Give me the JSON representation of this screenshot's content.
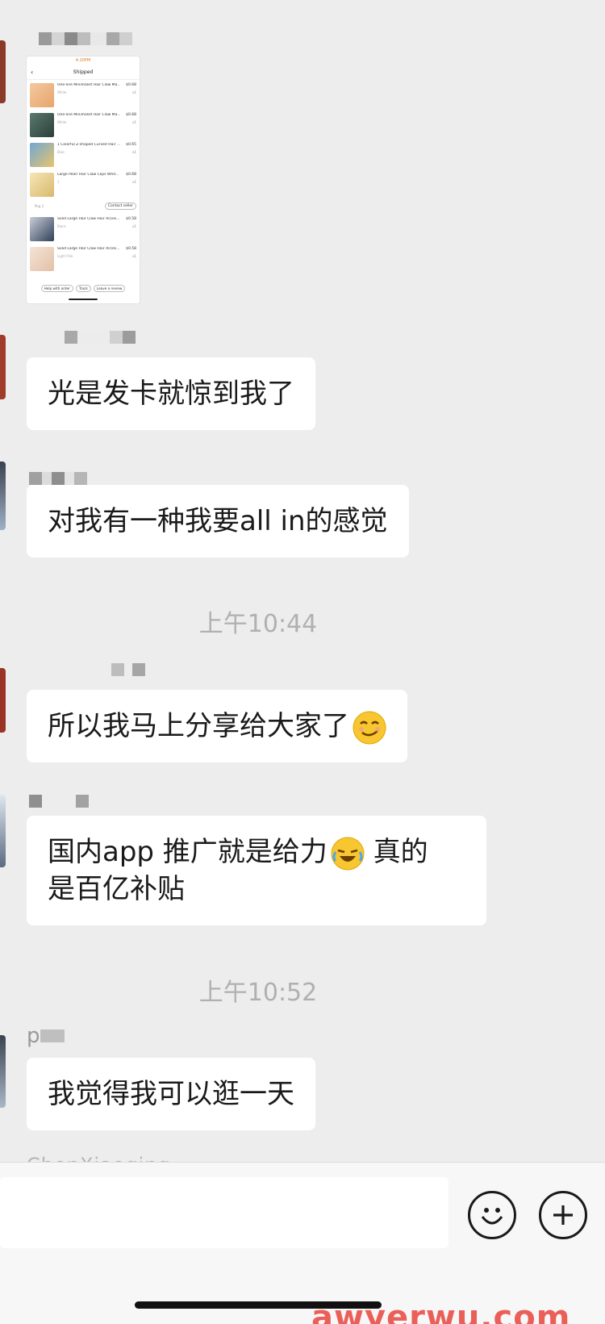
{
  "embedded_screenshot": {
    "status_time": "4:20PM",
    "title": "Shipped",
    "items": [
      {
        "name": "One-line Minimalist Hair Claw Ma...",
        "price": "$0.68",
        "variant": "White",
        "qty": "x1"
      },
      {
        "name": "One-line Minimalist Hair Claw Ma...",
        "price": "$0.68",
        "variant": "White",
        "qty": "x1"
      },
      {
        "name": "1 Colorful Z-shaped Curved Hair ...",
        "price": "$0.65",
        "variant": "Blue",
        "qty": "x1"
      },
      {
        "name": "Large Pearl Hair Claw Clips Whit...",
        "price": "$0.68",
        "variant": "1",
        "qty": "x1"
      },
      {
        "name": "Solid Large Hair Claw Hair Acces...",
        "price": "$0.58",
        "variant": "Black",
        "qty": "x1"
      },
      {
        "name": "Solid Large Hair Claw Hair Acces...",
        "price": "$0.58",
        "variant": "Light Pink",
        "qty": "x1"
      }
    ],
    "package_label": "Pkg 2",
    "contact_seller": "Contact seller",
    "actions": [
      "Help with order",
      "Track",
      "Leave a review"
    ]
  },
  "messages": [
    {
      "text": "光是发卡就惊到我了"
    },
    {
      "text": "对我有一种我要all in的感觉"
    },
    {
      "text": "所以我马上分享给大家了"
    },
    {
      "line1": "国内app 推广就是给力",
      "line1b": " 真的",
      "line2": "是百亿补贴"
    },
    {
      "text": "我觉得我可以逛一天"
    }
  ],
  "timestamps": [
    "上午10:44",
    "上午10:52"
  ],
  "sender_partial": "p",
  "sender_cut": "ChenXiaoqing",
  "watermark": "awyerwu.com",
  "icons": {
    "emoji_button": "smiley-face-icon",
    "plus_button": "plus-circle-icon"
  },
  "colors": {
    "background": "#ededed",
    "bubble": "#ffffff",
    "timestamp": "#b0b0b0",
    "watermark": "#e8463e"
  }
}
